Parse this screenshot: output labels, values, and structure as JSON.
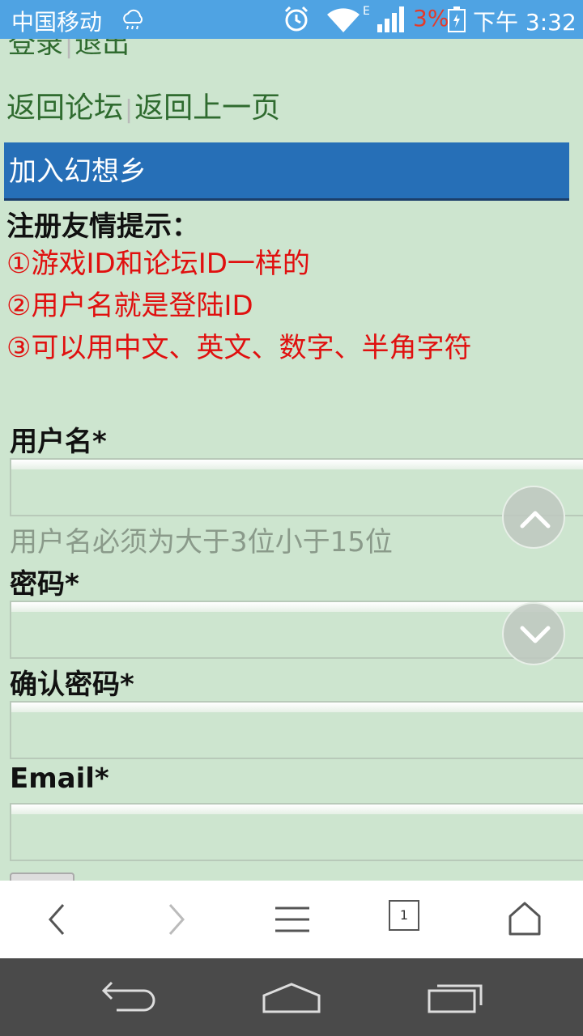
{
  "status_bar": {
    "carrier": "中国移动",
    "network_type": "E",
    "battery_percent": "3%",
    "time": "下午 3:32",
    "icons": [
      "weather-icon",
      "alarm-icon",
      "wifi-icon",
      "signal-icon",
      "battery-icon"
    ],
    "battery_color": "#e53a2a"
  },
  "top_links": {
    "login": "登录",
    "logout": "退出"
  },
  "nav_links": {
    "back_forum": "返回论坛",
    "back_prev": "返回上一页",
    "separator": "|"
  },
  "section": {
    "title": "加入幻想乡"
  },
  "tips": {
    "title": "注册友情提示：",
    "items": [
      "①游戏ID和论坛ID一样的",
      "②用户名就是登陆ID",
      "③可以用中文、英文、数字、半角字符"
    ]
  },
  "form": {
    "username_label": "用户名*",
    "username_value": "",
    "username_hint": "用户名必须为大于3位小于15位",
    "password_label": "密码*",
    "password_value": "",
    "confirm_label": "确认密码*",
    "confirm_value": "",
    "email_label": "Email*",
    "email_value": ""
  },
  "browser_bar": {
    "tab_count": "1",
    "icons": [
      "back-icon",
      "forward-icon",
      "menu-icon",
      "tabs-icon",
      "home-icon"
    ]
  },
  "colors": {
    "page_bg": "#cde5cf",
    "status_bar": "#4fa3e3",
    "header": "#266fb7",
    "link": "#2f6b2f",
    "tip_red": "#e0100f",
    "nav_bar": "#4a4a4a"
  }
}
